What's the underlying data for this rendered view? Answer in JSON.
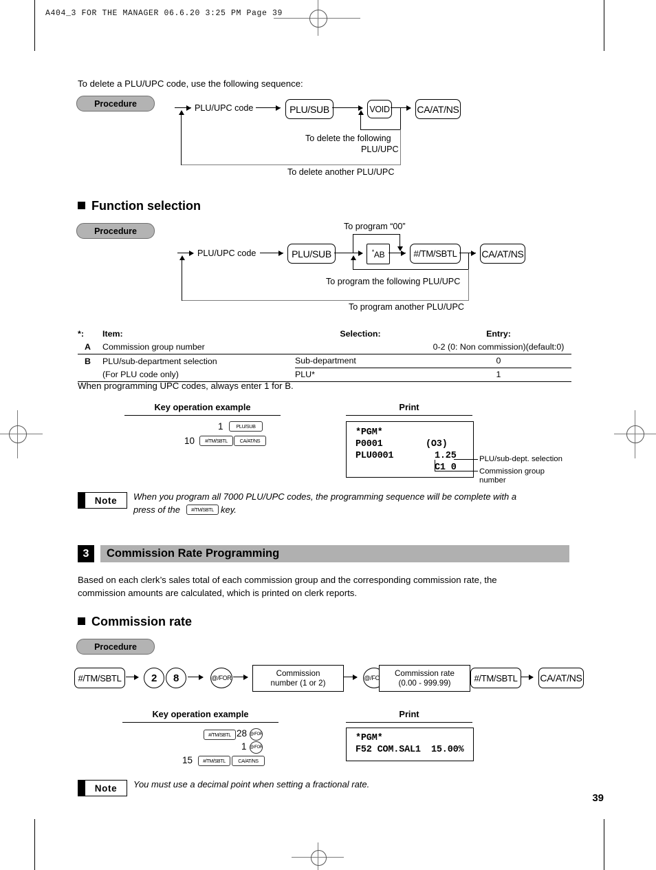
{
  "page": {
    "header_line": "A404_3 FOR THE MANAGER   06.6.20 3:25 PM   Page 39",
    "page_number": "39"
  },
  "intro": {
    "delete_text": "To delete a PLU/UPC code, use the following sequence:"
  },
  "procedure_label": "Procedure",
  "delete_flow": {
    "input_label": "PLU/UPC code",
    "keys": [
      "PLU/SUB",
      "VOID",
      "CA/AT/NS"
    ],
    "loop_inner_line1": "To delete the following",
    "loop_inner_line2": "PLU/UPC",
    "loop_outer": "To delete another PLU/UPC"
  },
  "function_selection": {
    "heading": "Function selection",
    "input_label": "PLU/UPC code",
    "keys": [
      "PLU/SUB",
      "*AB",
      "#/TM/SBTL",
      "CA/AT/NS"
    ],
    "ab_star": "*",
    "ab_text": "AB",
    "program_00": "To program “00”",
    "loop_inner": "To program the following PLU/UPC",
    "loop_outer": "To program another PLU/UPC"
  },
  "item_table": {
    "star_prefix": "*:",
    "headers": [
      "Item:",
      "Selection:",
      "Entry:"
    ],
    "rows": [
      {
        "item": "A",
        "desc": "Commission group number",
        "selection": "",
        "entry": "0-2 (0: Non commission)(default:0)"
      },
      {
        "item": "B",
        "desc": "PLU/sub-department selection",
        "selection": "Sub-department",
        "entry": "0"
      },
      {
        "item": "",
        "desc": "(For PLU code only)",
        "selection": "PLU*",
        "entry": "1"
      }
    ],
    "footnote": "When programming UPC codes, always enter 1 for B."
  },
  "example1": {
    "key_heading": "Key operation example",
    "print_heading": "Print",
    "row1_num": "1",
    "row1_key": "PLU/SUB",
    "row2_num": "10",
    "row2_keys": [
      "#/TM/SBTL",
      "CA/AT/NS"
    ],
    "receipt": {
      "line1": "*PGM*",
      "line2_left": "P0001",
      "line2_right": "(O3)",
      "line3_left": "PLU0001",
      "line3_right": "1.25",
      "line4": "C1 0"
    },
    "callout1": "PLU/sub-dept. selection",
    "callout2_l1": "Commission group",
    "callout2_l2": "number"
  },
  "note1": {
    "label": "Note",
    "text_before": "When you program all 7000 PLU/UPC codes, the programming sequence will be complete with a",
    "text_line2_before": "press of the",
    "key": "#/TM/SBTL",
    "text_after": "key."
  },
  "section3": {
    "number": "3",
    "title": "Commission Rate Programming",
    "paragraph_line1": "Based on each clerk’s sales total of each commission group and the corresponding commission rate, the",
    "paragraph_line2": "commission amounts are calculated, which is printed on clerk reports.",
    "subheading": "Commission rate"
  },
  "commission_flow": {
    "key1": "#/TM/SBTL",
    "digit1": "2",
    "digit2": "8",
    "key_for1": "@/FOR",
    "box1_line1": "Commission",
    "box1_line2": "number (1 or 2)",
    "key_for2": "@/FOR",
    "box2_line1": "Commission rate",
    "box2_line2": "(0.00 - 999.99)",
    "key2": "#/TM/SBTL",
    "key3": "CA/AT/NS"
  },
  "example2": {
    "key_heading": "Key operation example",
    "print_heading": "Print",
    "row1_key": "#/TM/SBTL",
    "row1_num": "28",
    "row1_for": "@/FOR",
    "row2_num": "1",
    "row2_for": "@/FOR",
    "row3_num": "15",
    "row3_keys": [
      "#/TM/SBTL",
      "CA/AT/NS"
    ],
    "receipt": {
      "line1": "*PGM*",
      "line2_left": "F52 COM.SAL1",
      "line2_right": "15.00%"
    }
  },
  "note2": {
    "label": "Note",
    "text": "You must use a decimal point when setting a fractional rate."
  }
}
